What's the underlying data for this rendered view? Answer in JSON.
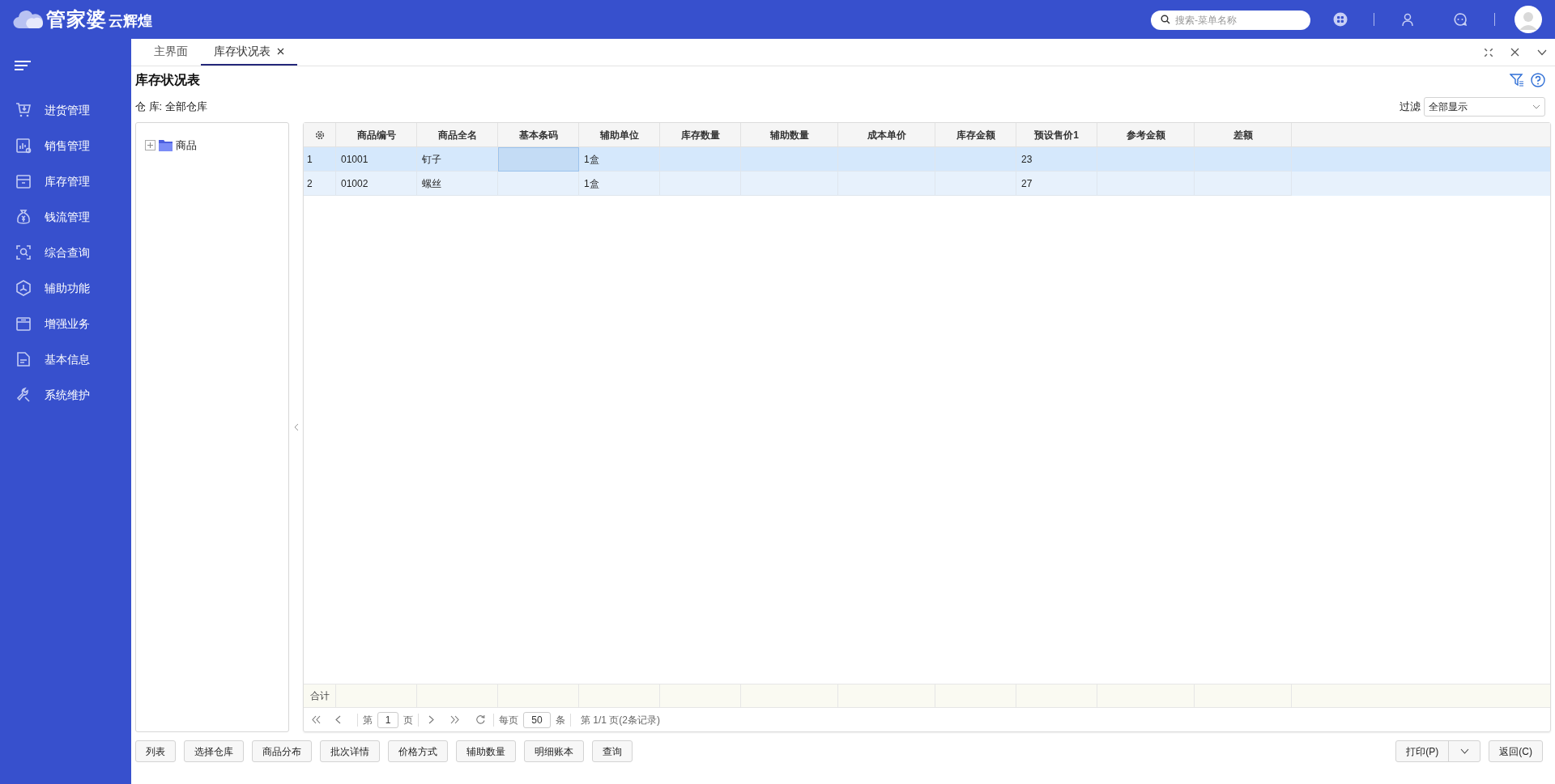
{
  "app": {
    "logo_text": "管家婆",
    "logo_suffix": "云辉煌",
    "search_placeholder": "搜索-菜单名称"
  },
  "sidebar": {
    "items": [
      {
        "label": "进货管理"
      },
      {
        "label": "销售管理"
      },
      {
        "label": "库存管理"
      },
      {
        "label": "钱流管理"
      },
      {
        "label": "综合查询"
      },
      {
        "label": "辅助功能"
      },
      {
        "label": "增强业务"
      },
      {
        "label": "基本信息"
      },
      {
        "label": "系统维护"
      }
    ]
  },
  "tabs": [
    {
      "label": "主界面",
      "selected": false,
      "closable": false
    },
    {
      "label": "库存状况表",
      "selected": true,
      "closable": true
    }
  ],
  "page_title": "库存状况表",
  "warehouse": "仓 库: 全部仓库",
  "filter": {
    "label": "过滤",
    "value": "全部显示"
  },
  "tree": [
    {
      "label": "商品",
      "expanded": false
    }
  ],
  "table": {
    "columns": [
      "商品编号",
      "商品全名",
      "基本条码",
      "辅助单位",
      "库存数量",
      "辅助数量",
      "成本单价",
      "库存金额",
      "预设售价1",
      "参考金额",
      "差额"
    ],
    "rows": [
      {
        "index": "1",
        "selected": true,
        "cells": [
          {
            "value": "01001",
            "focused": false
          },
          {
            "value": "钉子",
            "focused": false
          },
          {
            "focused": true
          },
          {
            "value": "1盒",
            "focused": false
          },
          {
            "focused": false
          },
          {
            "focused": false
          },
          {
            "focused": false
          },
          {
            "focused": false
          },
          {
            "value": "23",
            "focused": false
          },
          {
            "focused": false
          },
          {
            "focused": false
          }
        ]
      },
      {
        "index": "2",
        "selected": false,
        "cells": [
          {
            "value": "01002",
            "focused": false
          },
          {
            "value": "螺丝",
            "focused": false
          },
          {
            "focused": false
          },
          {
            "value": "1盒",
            "focused": false
          },
          {
            "focused": false
          },
          {
            "focused": false
          },
          {
            "focused": false
          },
          {
            "focused": false
          },
          {
            "value": "27",
            "focused": false
          },
          {
            "focused": false
          },
          {
            "focused": false
          }
        ]
      }
    ],
    "summary_label": "合计"
  },
  "pager": {
    "page_prefix": "第",
    "page": "1",
    "page_suffix": "页",
    "per_page_label": "每页",
    "per_page": "50",
    "per_page_suffix": "条",
    "info": "第 1/1 页(2条记录)"
  },
  "buttons": [
    "列表",
    "选择仓库",
    "商品分布",
    "批次详情",
    "价格方式",
    "辅助数量",
    "明细账本",
    "查询"
  ],
  "print_button": "打印(P)",
  "back_button": "返回(C)"
}
